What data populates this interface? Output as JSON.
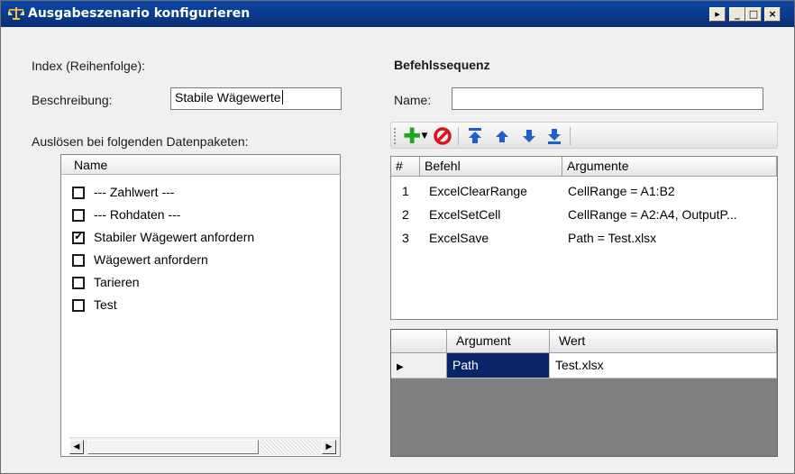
{
  "window": {
    "title": "Ausgabeszenario konfigurieren",
    "buttons": {
      "extra": "▸",
      "minimize": "_",
      "maximize": "□",
      "close": "×"
    }
  },
  "left": {
    "index_label": "Index (Reihenfolge):",
    "description_label": "Beschreibung:",
    "description_value": "Stabile Wägewerte",
    "trigger_label": "Auslösen bei folgenden Datenpaketen:",
    "list": {
      "column_header": "Name",
      "items": [
        {
          "label": "--- Zahlwert ---",
          "checked": false
        },
        {
          "label": "--- Rohdaten ---",
          "checked": false
        },
        {
          "label": "Stabiler Wägewert anfordern",
          "checked": true
        },
        {
          "label": "Wägewert anfordern",
          "checked": false
        },
        {
          "label": "Tarieren",
          "checked": false
        },
        {
          "label": "Test",
          "checked": false
        }
      ]
    }
  },
  "right": {
    "section_title": "Befehlssequenz",
    "name_label": "Name:",
    "name_value": "",
    "toolbar_icons": [
      "add-icon",
      "dropdown-arrow-icon",
      "delete-icon",
      "move-top-icon",
      "move-up-icon",
      "move-down-icon",
      "move-bottom-icon"
    ],
    "commands": {
      "headers": [
        "#",
        "Befehl",
        "Argumente"
      ],
      "rows": [
        {
          "num": "1",
          "command": "ExcelClearRange",
          "args": "CellRange = A1:B2"
        },
        {
          "num": "2",
          "command": "ExcelSetCell",
          "args": "CellRange = A2:A4, OutputP..."
        },
        {
          "num": "3",
          "command": "ExcelSave",
          "args": "Path = Test.xlsx"
        }
      ]
    },
    "arguments": {
      "headers": [
        "",
        "Argument",
        "Wert"
      ],
      "rows": [
        {
          "argument": "Path",
          "value": "Test.xlsx"
        }
      ]
    }
  },
  "colors": {
    "titlebar": "#0a2f74",
    "selection": "#0a246a",
    "add_green": "#1fa51f",
    "delete_red": "#d8141e",
    "arrow_blue": "#1e5fc9"
  }
}
